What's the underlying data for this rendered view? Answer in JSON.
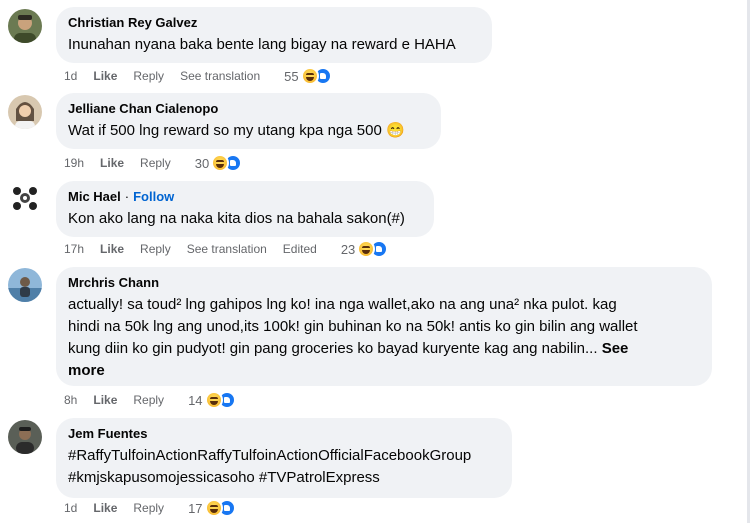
{
  "comments": [
    {
      "author": "Christian Rey Galvez",
      "text": "Inunahan nyana baka bente lang bigay na reward e HAHA",
      "time": "1d",
      "like": "Like",
      "reply": "Reply",
      "see_translation": "See translation",
      "reactions": "55"
    },
    {
      "author": "Jelliane Chan Cialenopo",
      "text": "Wat if 500 lng reward so my utang kpa nga 500 😁",
      "time": "19h",
      "like": "Like",
      "reply": "Reply",
      "reactions": "30"
    },
    {
      "author": "Mic Hael",
      "follow": "Follow",
      "separator": "·",
      "text": "Kon ako lang na naka kita dios na bahala sakon(#)",
      "time": "17h",
      "like": "Like",
      "reply": "Reply",
      "see_translation": "See translation",
      "edited": "Edited",
      "reactions": "23"
    },
    {
      "author": "Mrchris Chann",
      "text": "actually! sa toud² lng gahipos lng ko! ina nga wallet,ako na ang una² nka pulot. kag\nhindi na 50k lng ang unod,its 100k! gin buhinan ko na 50k! antis ko gin bilin ang wallet\nkung diin ko gin pudyot! gin pang groceries ko bayad kuryente kag ang nabilin...",
      "see_more": "See\nmore",
      "time": "8h",
      "like": "Like",
      "reply": "Reply",
      "reactions": "14"
    },
    {
      "author": "Jem Fuentes",
      "text": "#RaffyTulfoinActionRaffyTulfoinActionOfficialFacebookGroup\n#kmjskapusomojessicasoho #TVPatrolExpress",
      "time": "1d",
      "like": "Like",
      "reply": "Reply",
      "reactions": "17"
    }
  ],
  "reaction_icons": [
    "haha-icon",
    "like-icon"
  ],
  "colors": {
    "bubble": "#f0f2f5",
    "meta": "#65676b",
    "follow": "#0064d1",
    "like_blue": "#1877f2",
    "haha_yellow": "#f7b125"
  }
}
